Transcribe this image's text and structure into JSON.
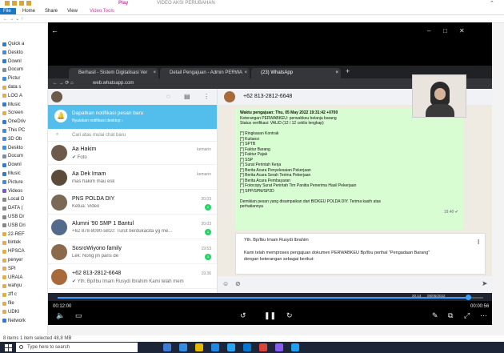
{
  "explorer": {
    "play_tab": "Play",
    "window_title": "VIDEO AKSI PERUBAHAN",
    "ribbon_tabs": [
      "File",
      "Home",
      "Share",
      "View",
      "Video Tools"
    ],
    "nav_items": [
      {
        "label": "Quick a",
        "color": "#2f7bd8"
      },
      {
        "label": "Deskto",
        "color": "#3a8ee6"
      },
      {
        "label": "Downl",
        "color": "#2f7bd8"
      },
      {
        "label": "Docum",
        "color": "#7a8ea8"
      },
      {
        "label": "Pictur",
        "color": "#3a8ee6"
      },
      {
        "label": "data s",
        "color": "#e0b040"
      },
      {
        "label": "LOG A",
        "color": "#e0b040"
      },
      {
        "label": "Music",
        "color": "#2f7bd8"
      },
      {
        "label": "Screen",
        "color": "#e0b040"
      },
      {
        "label": "OneDriv",
        "color": "#2f7bd8"
      },
      {
        "label": "This PC",
        "color": "#3a8ee6"
      },
      {
        "label": "3D Ob",
        "color": "#3a8ee6"
      },
      {
        "label": "Deskto",
        "color": "#3a8ee6"
      },
      {
        "label": "Docum",
        "color": "#7a8ea8"
      },
      {
        "label": "Downl",
        "color": "#2f7bd8"
      },
      {
        "label": "Music",
        "color": "#2f7bd8"
      },
      {
        "label": "Picture",
        "color": "#3a8ee6"
      },
      {
        "label": "Videos",
        "color": "#7a5ac8"
      },
      {
        "label": "Local D",
        "color": "#888888"
      },
      {
        "label": "DATA (",
        "color": "#888888"
      },
      {
        "label": "USB Dr",
        "color": "#888888"
      },
      {
        "label": "USB Dri",
        "color": "#888888"
      },
      {
        "label": "22-REF",
        "color": "#e0b040"
      },
      {
        "label": "bintek",
        "color": "#e0b040"
      },
      {
        "label": "HPSCA",
        "color": "#e0b040"
      },
      {
        "label": "penyer",
        "color": "#e0b040"
      },
      {
        "label": "SPI",
        "color": "#e0b040"
      },
      {
        "label": "URAIA",
        "color": "#e0b040"
      },
      {
        "label": "wahyu",
        "color": "#e0b040"
      },
      {
        "label": "zff c",
        "color": "#e0b040"
      },
      {
        "label": "file",
        "color": "#e0b040"
      },
      {
        "label": "UDKI",
        "color": "#e0b040"
      },
      {
        "label": "Network",
        "color": "#2f7bd8"
      }
    ],
    "status": "8 items    1 item selected  48,8 MB"
  },
  "taskbar": {
    "search_placeholder": "Type here to search",
    "apps": [
      "#3b7dd8",
      "#2f8de4",
      "#e6b800",
      "#1e88e5",
      "#2aa4f4",
      "#0078d4",
      "#db4437",
      "#8a5cf6",
      "#1da1f2"
    ]
  },
  "chrome": {
    "tabs": [
      {
        "label": "Berhasil - Sistem Digitalisasi Ver",
        "active": false
      },
      {
        "label": "Detail Pengajuan - Admin PERWA",
        "active": false
      },
      {
        "label": "(23) WhatsApp",
        "active": true
      }
    ],
    "url": "web.whatsapp.com"
  },
  "whatsapp": {
    "notif_title": "Dapatkan notifikasi pesan baru",
    "notif_sub": "Nyalakan notifikasi desktop ›",
    "search_placeholder": "Cari atau mulai chat baru",
    "chats": [
      {
        "name": "Aa Hakim",
        "preview": "✔ Foto",
        "time": "kemarin",
        "badge": "",
        "color": "#6d5a4a"
      },
      {
        "name": "Aa Dek Imam",
        "preview": "mas hakim mau esk",
        "time": "kemarin",
        "badge": "",
        "color": "#5a4b3b"
      },
      {
        "name": "PNS POLDA DIY",
        "preview": "Ketua: Video",
        "time": "20.03",
        "badge": "2",
        "color": "#7a6a55"
      },
      {
        "name": "Alumni '90 SMP 1 Bantul",
        "preview": "+62 878-8090-5810: Turut berdukacita yg me...",
        "time": "20.03",
        "badge": "1",
        "color": "#546a8a"
      },
      {
        "name": "SosroWiyono family",
        "preview": "Lek: Nong jln paris de",
        "time": "19.53",
        "badge": "3",
        "color": "#8a6a4a"
      },
      {
        "name": "+62 813-2812-6648",
        "preview": "✔ Yth. Bp/Ibu Imam Rusydi Ibrahim Kami telah mem",
        "time": "19.36",
        "badge": "",
        "color": "#a86a3a"
      }
    ],
    "contact": "+62 813-2812-6648",
    "message_lines": [
      {
        "text": "Waktu pengajuan: Thu, 05 May 2022 19:31:42 +0700",
        "bold": true
      },
      {
        "text": "Keterangan PERWABKEU: perwabkeu belanja barang",
        "bold": false
      },
      {
        "text": "Status verifikasi: VALID (12 / 12 ceklis lengkap)",
        "bold": false
      },
      {
        "text": "",
        "bold": false
      },
      {
        "text": "[*] Ringkasan Kontrak",
        "bold": false
      },
      {
        "text": "[*] Kuitansi",
        "bold": false
      },
      {
        "text": "[*] SPTB",
        "bold": false
      },
      {
        "text": "[*] Faktur Barang",
        "bold": false
      },
      {
        "text": "[*] Faktur Pajak",
        "bold": false
      },
      {
        "text": "[*] SSP",
        "bold": false
      },
      {
        "text": "[*] Surat Perintah Kerja",
        "bold": false
      },
      {
        "text": "[*] Berita Acara Penyelesaian Pekerjaan",
        "bold": false
      },
      {
        "text": "[*] Berita Acara Serah Terima Pekerjaan",
        "bold": false
      },
      {
        "text": "[*] Berita Acara Pembayaran",
        "bold": false
      },
      {
        "text": "[*] Fotocopy Surat Perintah Tim Panitia Penerima Hasil Pekerjaan",
        "bold": false
      },
      {
        "text": "[*] SPP/SPM/SP2D",
        "bold": false
      },
      {
        "text": "",
        "bold": false
      },
      {
        "text": "Demikian pesan yang disampaikan dari BIDKEU POLDA DIY. Terima kasih atas",
        "bold": false
      },
      {
        "text": "perhatiannya",
        "bold": false
      }
    ],
    "message_time": "19.40 ✔",
    "typing_lines": [
      "Yth. Bp/Ibu Imam Rusydi Ibrahim",
      "",
      "Kami telah memproses pengajuan dokumen PERWABKEU Bp/Ibu perihal \"Pengadaan Barang\"",
      "dengan keterangan sebagai berikut:"
    ]
  },
  "player": {
    "current_time": "00:12:00",
    "total_time": "00:00:56",
    "progress": 0.965,
    "accent": "#3aa0ff"
  },
  "inner_clock": {
    "time": "20.14",
    "date": "05/05/2022"
  }
}
